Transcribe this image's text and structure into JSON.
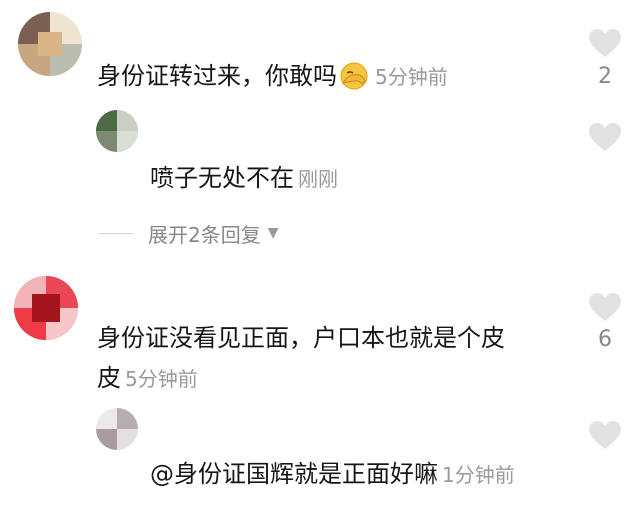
{
  "comments": [
    {
      "text": "身份证转过来，你敢吗",
      "time": "5分钟前",
      "likes": "2"
    },
    {
      "text": "喷子无处不在",
      "time": "刚刚"
    },
    {
      "text": "身份证没看见正面，户口本也就是个皮",
      "text_cont": "皮",
      "time": "5分钟前",
      "likes": "6"
    },
    {
      "text": "@身份证国辉就是正面好嘛",
      "time": "1分钟前"
    }
  ],
  "expand_replies": {
    "label": "展开2条回复",
    "icon": "chevron-down-icon"
  },
  "icons": {
    "like": "heart-icon",
    "emoji": "facepalm-emoji-icon"
  },
  "colors": {
    "heart": "#e2e2e2",
    "secondary_text": "#9a9a9a",
    "primary_text": "#161616"
  }
}
